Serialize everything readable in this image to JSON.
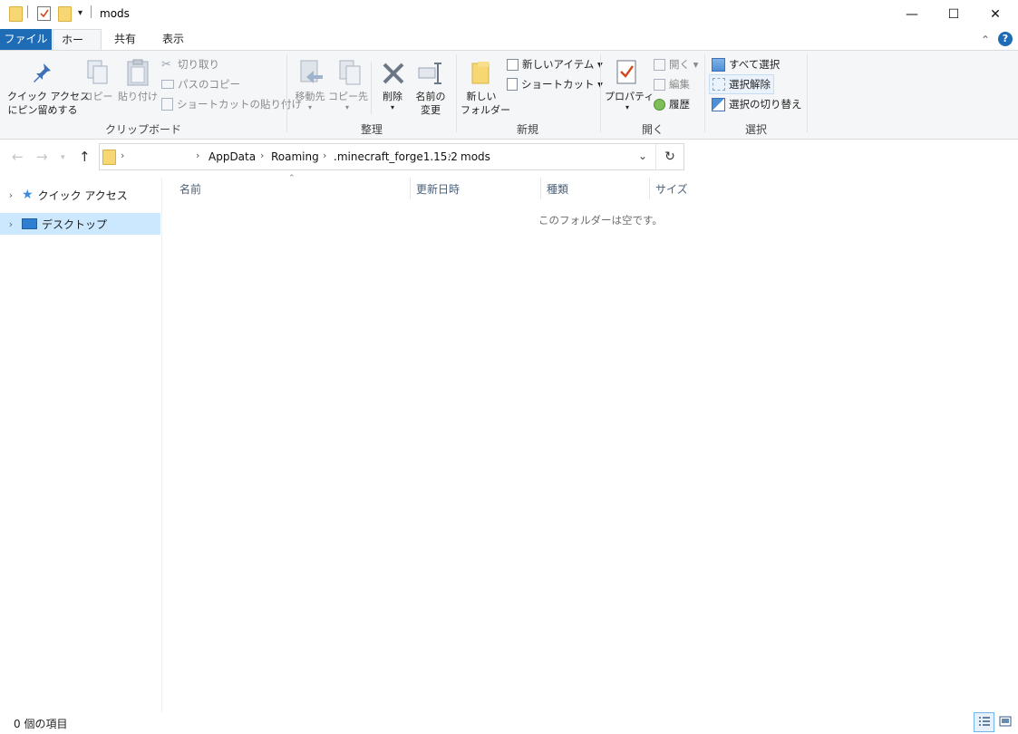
{
  "window": {
    "title": "mods",
    "minimize_glyph": "—",
    "maximize_glyph": "☐",
    "close_glyph": "✕"
  },
  "tabs": [
    {
      "label": "ファイル"
    },
    {
      "label": "ホーム"
    },
    {
      "label": "共有"
    },
    {
      "label": "表示"
    }
  ],
  "ribbon": {
    "clipboard": {
      "label": "クリップボード",
      "pin_label_1": "クイック アクセス",
      "pin_label_2": "にピン留めする",
      "copy_label": "コピー",
      "paste_label": "貼り付け",
      "cut_label": "切り取り",
      "copy_path_label": "パスのコピー",
      "paste_shortcut_label": "ショートカットの貼り付け"
    },
    "organize": {
      "label": "整理",
      "move_to_label": "移動先",
      "copy_to_label": "コピー先",
      "delete_label": "削除",
      "rename_label_1": "名前の",
      "rename_label_2": "変更"
    },
    "new": {
      "label": "新規",
      "new_folder_label_1": "新しい",
      "new_folder_label_2": "フォルダー",
      "new_item_label": "新しいアイテム ▾",
      "easy_access_label": "ショートカット ▾"
    },
    "open": {
      "label": "開く",
      "properties_label": "プロパティ",
      "open_label": "開く ▾",
      "edit_label": "編集",
      "history_label": "履歴"
    },
    "select": {
      "label": "選択",
      "select_all_label": "すべて選択",
      "select_none_label": "選択解除",
      "invert_label": "選択の切り替え"
    }
  },
  "address": {
    "crumbs": [
      "AppData",
      "Roaming",
      ".minecraft_forge1.15.2",
      "mods"
    ]
  },
  "nav": {
    "items": [
      {
        "label": "クイック アクセス"
      },
      {
        "label": "デスクトップ"
      }
    ]
  },
  "columns": {
    "name": "名前",
    "modified": "更新日時",
    "type": "種類",
    "size": "サイズ"
  },
  "content": {
    "empty_message": "このフォルダーは空です。"
  },
  "status": {
    "item_count": "0 個の項目"
  },
  "colors": {
    "file_tab": "#1e6cb5",
    "selection": "#cce8ff",
    "help": "#1e6cb5",
    "folder": "#f7d774"
  }
}
